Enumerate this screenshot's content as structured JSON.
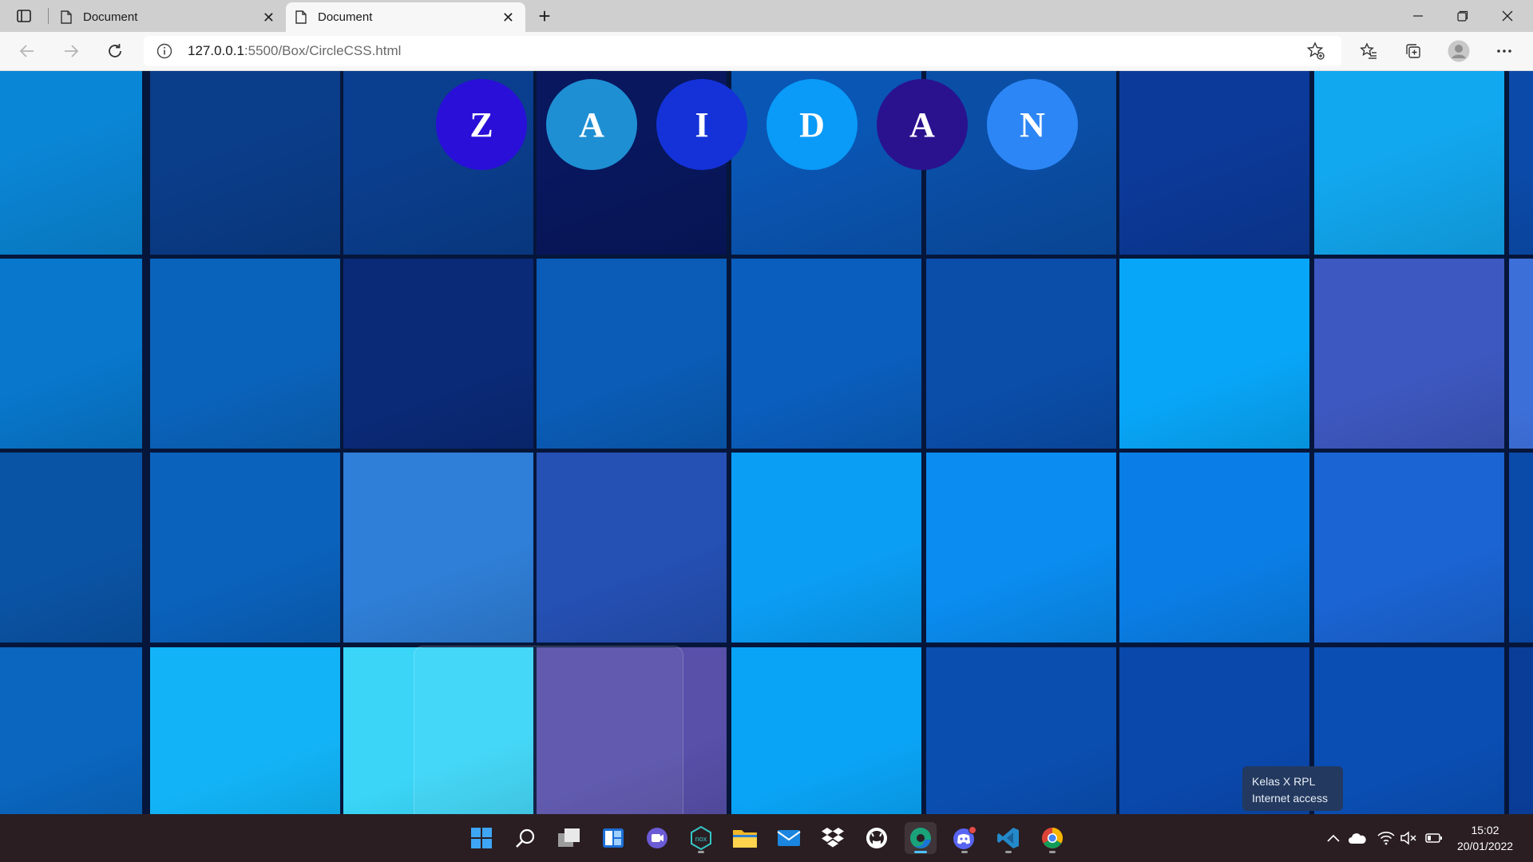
{
  "browser": {
    "tabs": [
      {
        "title": "Document",
        "active": false
      },
      {
        "title": "Document",
        "active": true
      }
    ],
    "address": {
      "host": "127.0.0.1",
      "path": ":5500/Box/CircleCSS.html"
    }
  },
  "page": {
    "circles": [
      {
        "letter": "Z",
        "color": "#2a0fd8"
      },
      {
        "letter": "A",
        "color": "#1f8fd3"
      },
      {
        "letter": "I",
        "color": "#1432d8"
      },
      {
        "letter": "D",
        "color": "#0a9af7"
      },
      {
        "letter": "A",
        "color": "#2a128f"
      },
      {
        "letter": "N",
        "color": "#2d86f5"
      }
    ]
  },
  "network_tooltip": {
    "line1": "Kelas X RPL",
    "line2": "Internet access"
  },
  "taskbar": {
    "apps": [
      "start-icon",
      "search-icon",
      "task-view-icon",
      "widgets-icon",
      "chat-icon",
      "nox-icon",
      "file-explorer-icon",
      "mail-icon",
      "dropbox-icon",
      "github-icon",
      "edge-icon",
      "discord-icon",
      "vscode-icon",
      "chrome-icon"
    ],
    "time": "15:02",
    "date": "20/01/2022"
  }
}
